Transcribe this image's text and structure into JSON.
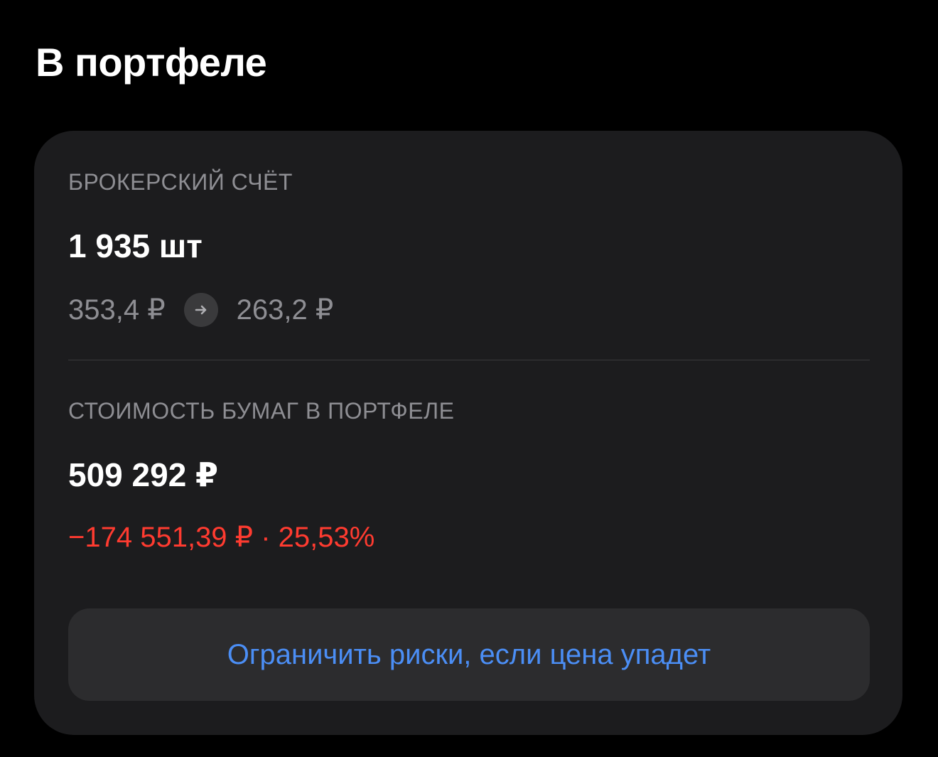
{
  "header": {
    "title": "В портфеле"
  },
  "brokerage": {
    "label": "БРОКЕРСКИЙ СЧЁТ",
    "quantity": "1 935 шт",
    "avg_price": "353,4 ₽",
    "arrow_icon": "arrow-right-icon",
    "current_price": "263,2 ₽"
  },
  "portfolio_value": {
    "label": "СТОИМОСТЬ БУМАГ В ПОРТФЕЛЕ",
    "value": "509 292 ₽",
    "change": "−174 551,39 ₽ · 25,53%"
  },
  "action": {
    "label": "Ограничить риски, если цена упадет"
  },
  "colors": {
    "background": "#000000",
    "card": "#1c1c1e",
    "secondary_text": "#8e8e93",
    "negative": "#ff3b30",
    "link": "#4b8ef5",
    "button_bg": "#2c2c2e"
  }
}
